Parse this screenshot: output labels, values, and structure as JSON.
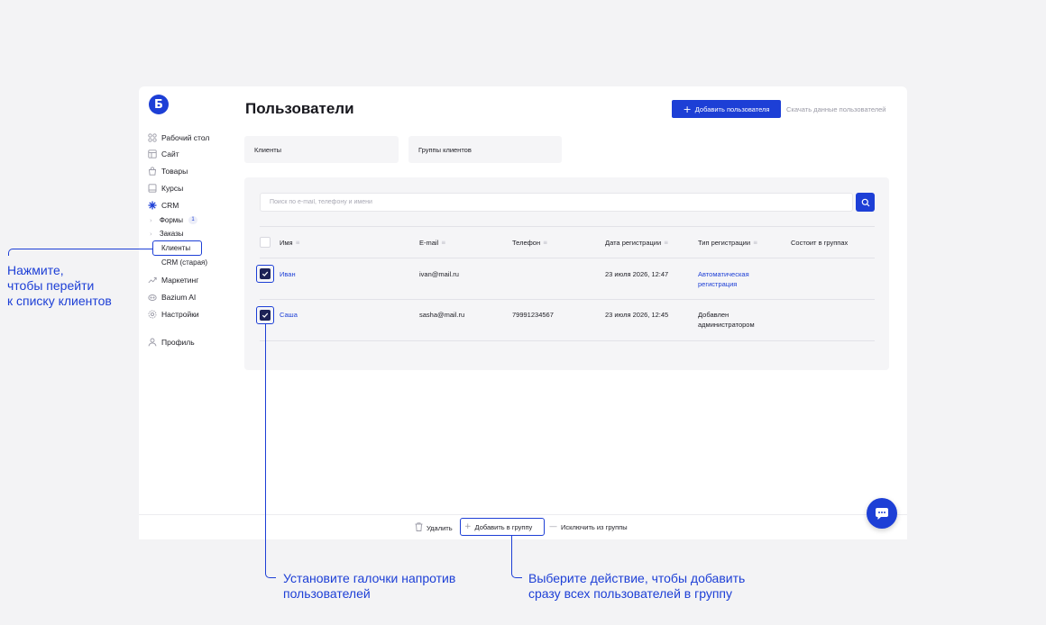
{
  "sidebar": {
    "logo": "Б",
    "items": [
      {
        "label": "Рабочий стол",
        "icon": "grid-icon"
      },
      {
        "label": "Сайт",
        "icon": "layout-icon"
      },
      {
        "label": "Товары",
        "icon": "bag-icon"
      },
      {
        "label": "Курсы",
        "icon": "book-icon"
      },
      {
        "label": "CRM",
        "icon": "crm-icon"
      },
      {
        "label": "Формы",
        "badge": "1"
      },
      {
        "label": "Заказы"
      },
      {
        "label": "Клиенты"
      },
      {
        "label": "CRM (старая)"
      },
      {
        "label": "Маркетинг",
        "icon": "chart-icon"
      },
      {
        "label": "Bazium AI",
        "icon": "ai-icon"
      },
      {
        "label": "Настройки",
        "icon": "gear-icon"
      },
      {
        "label": "Профиль",
        "icon": "user-icon"
      }
    ]
  },
  "header": {
    "title": "Пользователи",
    "add_user": "Добавить пользователя",
    "download": "Скачать данные пользователей"
  },
  "tabs": [
    {
      "label": "Клиенты"
    },
    {
      "label": "Группы клиентов"
    }
  ],
  "search": {
    "placeholder": "Поиск по e-mail, телефону и имени"
  },
  "table": {
    "columns": [
      "Имя",
      "E-mail",
      "Телефон",
      "Дата регистрации",
      "Тип регистрации",
      "Состоит в группах"
    ],
    "rows": [
      {
        "name": "Иван",
        "email": "ivan@mail.ru",
        "phone": "",
        "date": "23 июля 2026, 12:47",
        "type": "Автоматическая регистрация",
        "groups": "",
        "checked": true
      },
      {
        "name": "Саша",
        "email": "sasha@mail.ru",
        "phone": "79991234567",
        "date": "23 июля 2026, 12:45",
        "type": "Добавлен администратором",
        "groups": "",
        "checked": true
      }
    ]
  },
  "bottom_bar": {
    "delete": "Удалить",
    "add_to_group": "Добавить в группу",
    "remove_from_group": "Исключить из группы"
  },
  "annotations": {
    "clients_hint_1": "Нажмите,",
    "clients_hint_2": "чтобы перейти",
    "clients_hint_3": "к списку клиентов",
    "checkbox_hint_1": "Установите галочки напротив",
    "checkbox_hint_2": "пользователей",
    "action_hint_1": "Выберите действие, чтобы добавить",
    "action_hint_2": "сразу всех пользователей в группу"
  },
  "colors": {
    "accent": "#1d3fd6",
    "checkbox": "#1d2256",
    "background": "#f3f3f5"
  }
}
